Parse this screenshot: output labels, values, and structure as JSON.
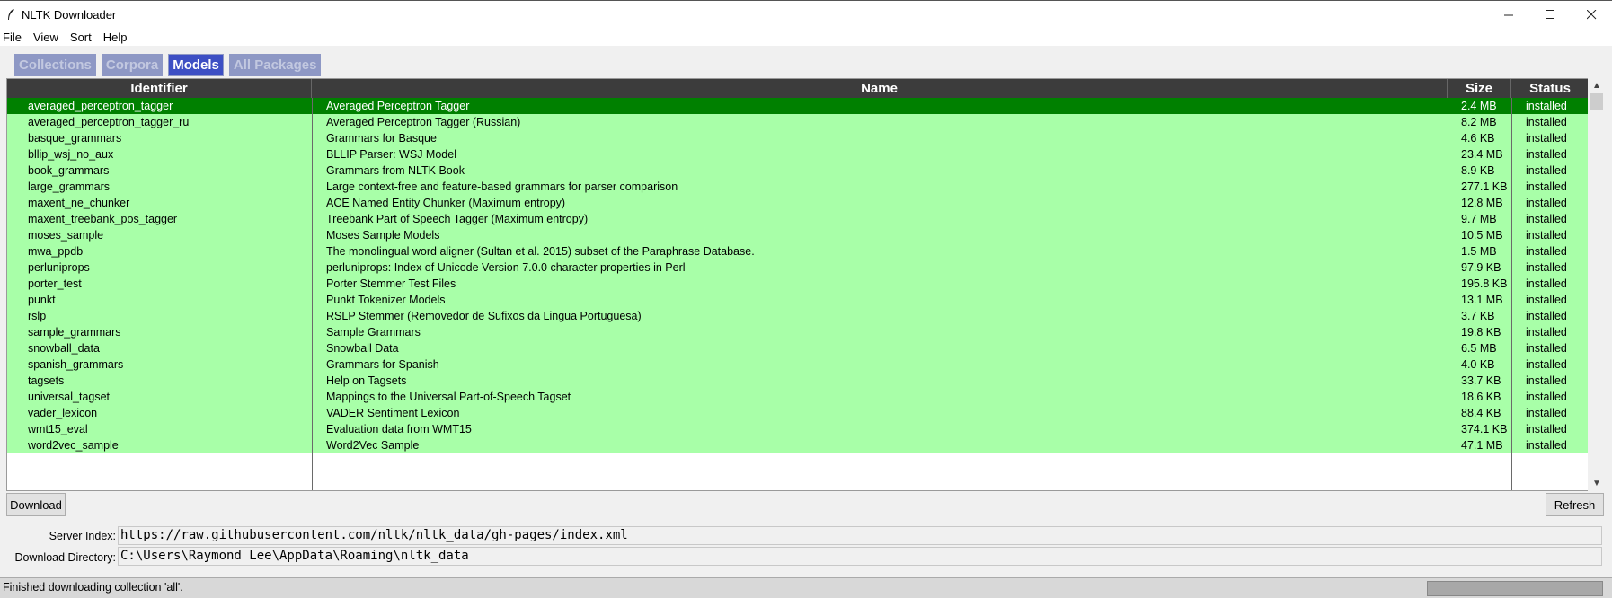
{
  "window": {
    "title": "NLTK Downloader"
  },
  "menu": [
    "File",
    "View",
    "Sort",
    "Help"
  ],
  "tabs": [
    {
      "label": "Collections",
      "active": false
    },
    {
      "label": "Corpora",
      "active": false
    },
    {
      "label": "Models",
      "active": true
    },
    {
      "label": "All Packages",
      "active": false
    }
  ],
  "table": {
    "columns": [
      "Identifier",
      "Name",
      "Size",
      "Status"
    ],
    "rows": [
      [
        "averaged_perceptron_tagger",
        "Averaged Perceptron Tagger",
        "2.4 MB",
        "installed"
      ],
      [
        "averaged_perceptron_tagger_ru",
        "Averaged Perceptron Tagger (Russian)",
        "8.2 MB",
        "installed"
      ],
      [
        "basque_grammars",
        "Grammars for Basque",
        "4.6 KB",
        "installed"
      ],
      [
        "bllip_wsj_no_aux",
        "BLLIP Parser: WSJ Model",
        "23.4 MB",
        "installed"
      ],
      [
        "book_grammars",
        "Grammars from NLTK Book",
        "8.9 KB",
        "installed"
      ],
      [
        "large_grammars",
        "Large context-free and feature-based grammars for parser comparison",
        "277.1 KB",
        "installed"
      ],
      [
        "maxent_ne_chunker",
        "ACE Named Entity Chunker (Maximum entropy)",
        "12.8 MB",
        "installed"
      ],
      [
        "maxent_treebank_pos_tagger",
        "Treebank Part of Speech Tagger (Maximum entropy)",
        "9.7 MB",
        "installed"
      ],
      [
        "moses_sample",
        "Moses Sample Models",
        "10.5 MB",
        "installed"
      ],
      [
        "mwa_ppdb",
        "The monolingual word aligner (Sultan et al. 2015) subset of the Paraphrase Database.",
        "1.5 MB",
        "installed"
      ],
      [
        "perluniprops",
        "perluniprops: Index of Unicode Version 7.0.0 character properties in Perl",
        "97.9 KB",
        "installed"
      ],
      [
        "porter_test",
        "Porter Stemmer Test Files",
        "195.8 KB",
        "installed"
      ],
      [
        "punkt",
        "Punkt Tokenizer Models",
        "13.1 MB",
        "installed"
      ],
      [
        "rslp",
        "RSLP Stemmer (Removedor de Sufixos da Lingua Portuguesa)",
        "3.7 KB",
        "installed"
      ],
      [
        "sample_grammars",
        "Sample Grammars",
        "19.8 KB",
        "installed"
      ],
      [
        "snowball_data",
        "Snowball Data",
        "6.5 MB",
        "installed"
      ],
      [
        "spanish_grammars",
        "Grammars for Spanish",
        "4.0 KB",
        "installed"
      ],
      [
        "tagsets",
        "Help on Tagsets",
        "33.7 KB",
        "installed"
      ],
      [
        "universal_tagset",
        "Mappings to the Universal Part-of-Speech Tagset",
        "18.6 KB",
        "installed"
      ],
      [
        "vader_lexicon",
        "VADER Sentiment Lexicon",
        "88.4 KB",
        "installed"
      ],
      [
        "wmt15_eval",
        "Evaluation data from WMT15",
        "374.1 KB",
        "installed"
      ],
      [
        "word2vec_sample",
        "Word2Vec Sample",
        "47.1 MB",
        "installed"
      ]
    ],
    "selected_row": 0
  },
  "buttons": {
    "download": "Download",
    "refresh": "Refresh"
  },
  "fields": {
    "server_index_label": "Server Index:",
    "server_index_value": "https://raw.githubusercontent.com/nltk/nltk_data/gh-pages/index.xml",
    "download_dir_label": "Download Directory:",
    "download_dir_value": "C:\\Users\\Raymond Lee\\AppData\\Roaming\\nltk_data"
  },
  "status": {
    "text": "Finished downloading collection 'all'."
  },
  "colors": {
    "row_installed": "#a8ffa8",
    "row_selected": "#008000",
    "tab_active": "#3d4fc4",
    "tab_inactive": "#8e98c5",
    "header": "#3c3c3c"
  }
}
